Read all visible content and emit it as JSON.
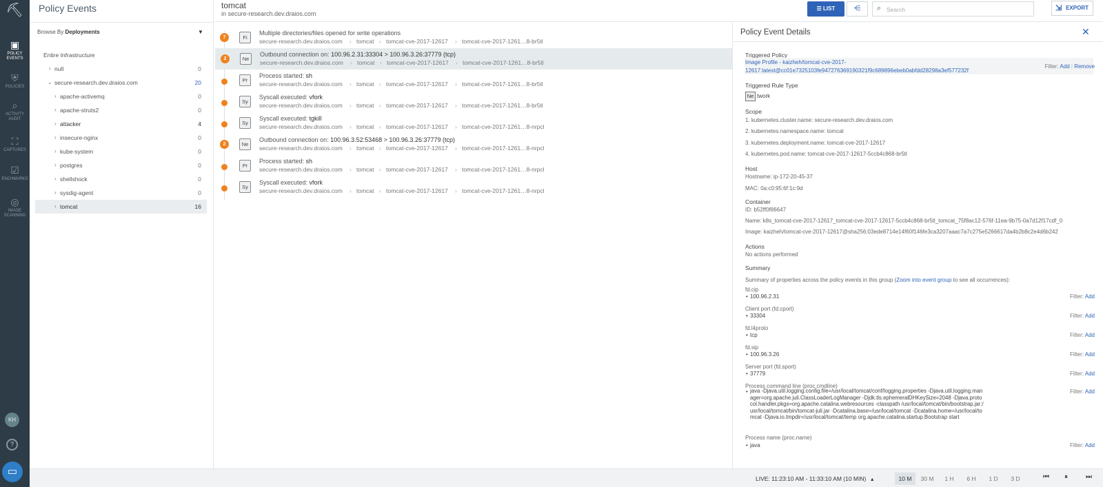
{
  "rail": {
    "items": [
      {
        "label": "POLICY EVENTS",
        "label1": "POLICY",
        "label2": "EVENTS",
        "icon": "alert-icon",
        "active": true
      },
      {
        "label1": "POLICIES",
        "label2": "",
        "icon": "shield-icon"
      },
      {
        "label1": "ACTIVITY",
        "label2": "AUDIT",
        "icon": "search-icon"
      },
      {
        "label1": "CAPTURES",
        "label2": "",
        "icon": "capture-icon"
      },
      {
        "label1": "ENCHMARKS",
        "label2": "",
        "icon": "benchmark-icon"
      },
      {
        "label1": "IMAGE",
        "label2": "SCANNING",
        "icon": "scan-icon"
      }
    ],
    "avatar": "KH"
  },
  "tree_panel": {
    "title": "Policy Events",
    "browse_prefix": "Browse By",
    "browse_value": "Deployments",
    "root": "Entire Infrastructure",
    "items": [
      {
        "label": "null",
        "count": "0",
        "level": 1
      },
      {
        "label": "secure-research.dev.draios.com",
        "count": "20",
        "level": 1,
        "expanded": true
      },
      {
        "label": "apache-activemq",
        "count": "0",
        "level": 2
      },
      {
        "label": "apache-struts2",
        "count": "0",
        "level": 2
      },
      {
        "label": "attacker",
        "count": "4",
        "level": 2
      },
      {
        "label": "insecure-nginx",
        "count": "0",
        "level": 2
      },
      {
        "label": "kube-system",
        "count": "0",
        "level": 2
      },
      {
        "label": "postgres",
        "count": "0",
        "level": 2
      },
      {
        "label": "shellshock",
        "count": "0",
        "level": 2
      },
      {
        "label": "sysdig-agent",
        "count": "0",
        "level": 2
      },
      {
        "label": "tomcat",
        "count": "16",
        "level": 2,
        "selected": true
      }
    ]
  },
  "header": {
    "title": "tomcat",
    "subtitle": "in secure-research.dev.draios.com",
    "list_label": "LIST",
    "search_placeholder": "Search",
    "export_label": "EXPORT"
  },
  "events": [
    {
      "badge": "7",
      "tag": "Fi",
      "title": "Multiple directories/files opened for write operations",
      "detail": "",
      "crumbs": [
        "secure-research.dev.draios.com",
        "tomcat",
        "tomcat-cve-2017-12617",
        "tomcat-cve-2017-1261…8-br5tl"
      ]
    },
    {
      "badge": "2",
      "tag": "Ne",
      "title": "Outbound connection on: ",
      "detail": "100.96.2.31:33304 > 100.96.3.26:37779 (tcp)",
      "crumbs": [
        "secure-research.dev.draios.com",
        "tomcat",
        "tomcat-cve-2017-12617",
        "tomcat-cve-2017-1261…8-br5tl"
      ],
      "selected": true
    },
    {
      "badge": "",
      "tag": "Pr",
      "title": "Process started: ",
      "detail": "sh",
      "crumbs": [
        "secure-research.dev.draios.com",
        "tomcat",
        "tomcat-cve-2017-12617",
        "tomcat-cve-2017-1261…8-br5tl"
      ]
    },
    {
      "badge": "",
      "tag": "Sy",
      "title": "Syscall executed: ",
      "detail": "vfork",
      "crumbs": [
        "secure-research.dev.draios.com",
        "tomcat",
        "tomcat-cve-2017-12617",
        "tomcat-cve-2017-1261…8-br5tl"
      ]
    },
    {
      "badge": "",
      "tag": "Sy",
      "title": "Syscall executed: ",
      "detail": "tgkill",
      "crumbs": [
        "secure-research.dev.draios.com",
        "tomcat",
        "tomcat-cve-2017-12617",
        "tomcat-cve-2017-1261…8-nrpcl"
      ]
    },
    {
      "badge": "2",
      "tag": "Ne",
      "title": "Outbound connection on: ",
      "detail": "100.96.3.52:53468 > 100.96.3.26:37779 (tcp)",
      "crumbs": [
        "secure-research.dev.draios.com",
        "tomcat",
        "tomcat-cve-2017-12617",
        "tomcat-cve-2017-1261…8-nrpcl"
      ]
    },
    {
      "badge": "",
      "tag": "Pr",
      "title": "Process started: ",
      "detail": "sh",
      "crumbs": [
        "secure-research.dev.draios.com",
        "tomcat",
        "tomcat-cve-2017-12617",
        "tomcat-cve-2017-1261…8-nrpcl"
      ]
    },
    {
      "badge": "",
      "tag": "Sy",
      "title": "Syscall executed: ",
      "detail": "vfork",
      "crumbs": [
        "secure-research.dev.draios.com",
        "tomcat",
        "tomcat-cve-2017-12617",
        "tomcat-cve-2017-1261…8-nrpcl"
      ]
    }
  ],
  "details": {
    "title": "Policy Event Details",
    "triggered_policy_label": "Triggered Policy",
    "triggered_policy_line1": "Image Profile - kaizheh/tomcat-cve-2017-",
    "triggered_policy_line2": "12617:latest@cc01e7325103fe947276369190321f9c689896ebeb0abfdd28298a3ef577232f",
    "filter_label": "Filter:",
    "add_label": "Add",
    "remove_label": "Remove",
    "rule_type_label": "Triggered Rule Type",
    "rule_type_tag": "Ne",
    "rule_type_text": "twork",
    "scope_label": "Scope",
    "scope": [
      "1. kubernetes.cluster.name: secure-research.dev.draios.com",
      "2. kubernetes.namespace.name: tomcat",
      "3. kubernetes.deployment.name: tomcat-cve-2017-12617",
      "4. kubernetes.pod.name: tomcat-cve-2017-12617-5ccb4c868-br5tl"
    ],
    "host_label": "Host",
    "hostname": "Hostname: ip-172-20-45-37",
    "mac": "MAC: 0a:c0:95:6f:1c:9d",
    "container_label": "Container",
    "container_id": "ID: b52ff0f86647",
    "container_name": "Name: k8s_tomcat-cve-2017-12617_tomcat-cve-2017-12617-5ccb4c868-br5tl_tomcat_75f8ac12-576f-11ea-9b75-0a7d12f17cdf_0",
    "container_image": "Image: kaizheh/tomcat-cve-2017-12617@sha256:03ede8714e14f60f146fe3ca3207aaac7a7c275e5266617da4b2b8c2e4d6b242",
    "actions_label": "Actions",
    "actions_value": "No actions performed",
    "summary_label": "Summary",
    "summary_text_pre": "Summary of properties across the policy events in this group (",
    "summary_link": "Zoom into event group",
    "summary_text_post": " to see all occurrences):",
    "props": [
      {
        "name": "fd.cip",
        "value": "100.96.2.31"
      },
      {
        "name": "Client port (fd.cport)",
        "value": "33304"
      },
      {
        "name": "fd.l4proto",
        "value": "tcp"
      },
      {
        "name": "fd.sip",
        "value": "100.96.3.26"
      },
      {
        "name": "Server port (fd.sport)",
        "value": "37779"
      }
    ],
    "cmdline_label": "Process command line (proc.cmdline)",
    "cmdline": "java -Djava.util.logging.config.file=/usr/local/tomcat/conf/logging.properties -Djava.util.logging.manager=org.apache.juli.ClassLoaderLogManager -Djdk.tls.ephemeralDHKeySize=2048 -Djava.protocol.handler.pkgs=org.apache.catalina.webresources -classpath /usr/local/tomcat/bin/bootstrap.jar:/usr/local/tomcat/bin/tomcat-juli.jar -Dcatalina.base=/usr/local/tomcat -Dcatalina.home=/usr/local/tomcat -Djava.io.tmpdir=/usr/local/tomcat/temp org.apache.catalina.startup.Bootstrap start",
    "procname_label": "Process name (proc.name)",
    "procname": "java"
  },
  "bottom": {
    "live": "LIVE: 11:23:10 AM - 11:33:10 AM (10 MIN)",
    "ranges": [
      "10 M",
      "30 M",
      "1 H",
      "6 H",
      "1 D",
      "3 D"
    ],
    "active_range": "10 M"
  },
  "colors": {
    "accent": "#2f63b8",
    "rail": "#2e3c47",
    "event_dot": "#f0821e"
  }
}
